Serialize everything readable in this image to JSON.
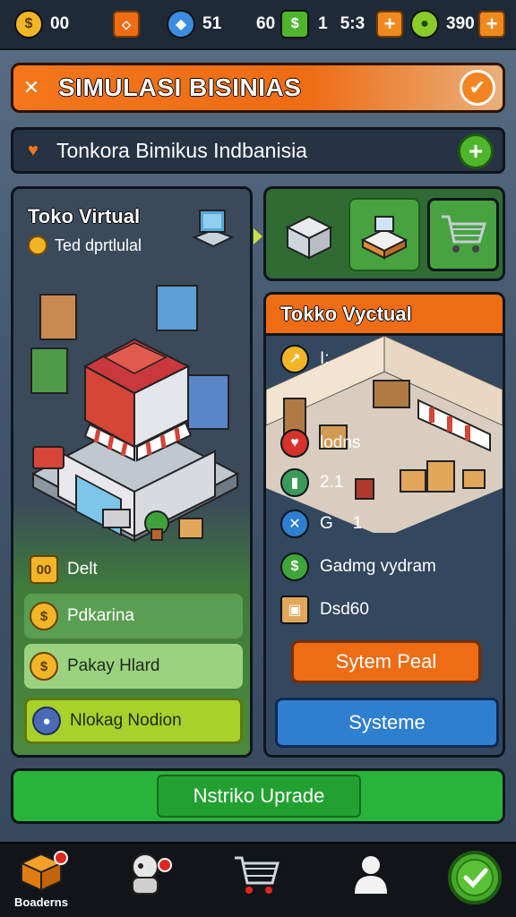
{
  "top_bar": {
    "coins": {
      "icon": "gold-coin-icon",
      "value": "00"
    },
    "gems": {
      "icon": "blue-gem-icon",
      "value": "51"
    },
    "dollars": {
      "icon": "green-cash-icon",
      "value": "60",
      "extra": "1",
      "time": "5:3"
    },
    "energy": {
      "icon": "green-coin-icon",
      "value": "390"
    },
    "plus_label": "+"
  },
  "title_bar": {
    "close_label": "✕",
    "title": "SIMULASI BISINIAS",
    "confirm_label": "✔"
  },
  "business_bar": {
    "name": "Tonkora Bimikus Indbanisia",
    "add_label": "+"
  },
  "left_panel": {
    "title": "Toko Virtual",
    "subtitle": "Ted dprtlulal",
    "debt": {
      "icon_text": "00",
      "label": "Delt"
    },
    "rows": [
      {
        "label": "Pdkarina"
      },
      {
        "label": "Pakay Hlard"
      },
      {
        "label": "Nlokag Nodion"
      }
    ]
  },
  "right_panel": {
    "header": "Tokko Vyctual",
    "stats": [
      {
        "icon": "chart-icon",
        "value": "I:"
      },
      {
        "icon": "heart-icon",
        "value": "lodns"
      },
      {
        "icon": "bottle-icon",
        "value": "2.1"
      },
      {
        "icon": "wrench-icon",
        "value": "G",
        "extra": "1"
      },
      {
        "icon": "dollar-icon",
        "value": "Gadmg vydram"
      },
      {
        "icon": "boxes-icon",
        "value": "Dsd60"
      }
    ],
    "orange_button": "Sytem Peal",
    "blue_button": "Systeme"
  },
  "upgrade_button": "Nstriko Uprade",
  "bottom_nav": [
    {
      "icon": "crate-icon",
      "label": "Boaderns"
    },
    {
      "icon": "character-icon",
      "label": ""
    },
    {
      "icon": "shopping-cart-icon",
      "label": ""
    },
    {
      "icon": "person-icon",
      "label": ""
    },
    {
      "icon": "green-check-icon",
      "label": ""
    }
  ],
  "colors": {
    "accent_orange": "#ee6c14",
    "accent_green": "#28b43a",
    "accent_blue": "#2f7fd0",
    "panel_dark": "#33475e"
  }
}
